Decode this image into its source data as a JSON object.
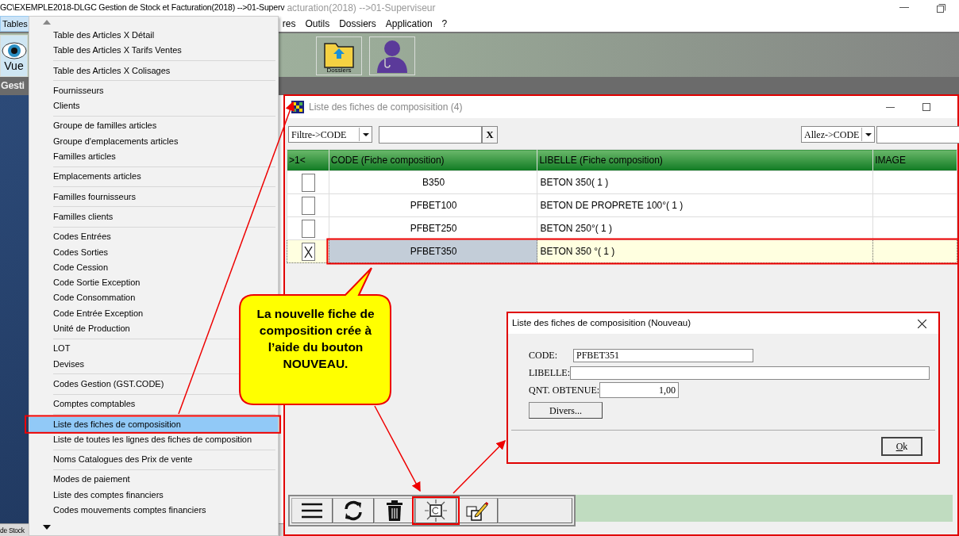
{
  "app": {
    "title": "GC\\EXEMPLE2018-DLGC Gestion de Stock et Facturation(2018) -->01-Superv",
    "title_behind": "acturation(2018) -->01-Superviseur",
    "menu": [
      {
        "label": "Tables",
        "selected": true
      },
      {
        "label": "res",
        "selected": false
      },
      {
        "label": "Outils",
        "selected": false
      },
      {
        "label": "Dossiers",
        "selected": false
      },
      {
        "label": "Application",
        "selected": false
      },
      {
        "label": "?",
        "selected": false
      }
    ],
    "toolbar": [
      {
        "kind": "vue",
        "label": "Vue"
      },
      {
        "kind": "folder",
        "label": "Dossiers"
      },
      {
        "kind": "user"
      }
    ],
    "band_title": "Gesti",
    "status": "de Stock"
  },
  "tables_menu": {
    "groups": [
      [
        {
          "label": "Table des Articles X Détail",
          "selected": false,
          "annotated": false
        },
        {
          "label": "Table des Articles X Tarifs Ventes",
          "selected": false,
          "annotated": false
        }
      ],
      [
        {
          "label": "Table des Articles X Colisages",
          "selected": false,
          "annotated": false
        }
      ],
      [
        {
          "label": "Fournisseurs",
          "selected": false,
          "annotated": false
        },
        {
          "label": "Clients",
          "selected": false,
          "annotated": false
        }
      ],
      [
        {
          "label": "Groupe de familles articles",
          "selected": false,
          "annotated": false
        },
        {
          "label": "Groupe d'emplacements articles",
          "selected": false,
          "annotated": false
        },
        {
          "label": "Familles articles",
          "selected": false,
          "annotated": false
        }
      ],
      [
        {
          "label": "Emplacements articles",
          "selected": false,
          "annotated": false
        }
      ],
      [
        {
          "label": "Familles fournisseurs",
          "selected": false,
          "annotated": false
        }
      ],
      [
        {
          "label": "Familles clients",
          "selected": false,
          "annotated": false
        }
      ],
      [
        {
          "label": "Codes Entrées",
          "selected": false,
          "annotated": false
        },
        {
          "label": "Codes Sorties",
          "selected": false,
          "annotated": false
        },
        {
          "label": "Code Cession",
          "selected": false,
          "annotated": false
        },
        {
          "label": "Code Sortie Exception",
          "selected": false,
          "annotated": false
        },
        {
          "label": "Code Consommation",
          "selected": false,
          "annotated": false
        },
        {
          "label": "Code Entrée Exception",
          "selected": false,
          "annotated": false
        },
        {
          "label": "Unité de Production",
          "selected": false,
          "annotated": false
        }
      ],
      [
        {
          "label": "LOT",
          "selected": false,
          "annotated": false
        },
        {
          "label": "Devises",
          "selected": false,
          "annotated": false
        }
      ],
      [
        {
          "label": "Codes Gestion (GST.CODE)",
          "selected": false,
          "annotated": false
        }
      ],
      [
        {
          "label": "Comptes comptables",
          "selected": false,
          "annotated": false
        }
      ],
      [
        {
          "label": "Liste des fiches de composisition",
          "selected": true,
          "annotated": true
        },
        {
          "label": "Liste de toutes les lignes des fiches de composition",
          "selected": false,
          "annotated": false
        }
      ],
      [
        {
          "label": "Noms Catalogues des Prix de vente",
          "selected": false,
          "annotated": false
        }
      ],
      [
        {
          "label": "Modes de paiement",
          "selected": false,
          "annotated": false
        },
        {
          "label": "Liste des comptes financiers",
          "selected": false,
          "annotated": false
        },
        {
          "label": "Codes mouvements comptes financiers",
          "selected": false,
          "annotated": false
        }
      ]
    ]
  },
  "list_window": {
    "title": "Liste des fiches de composisition (4)",
    "annotated": true,
    "filter": {
      "select": "Filtre->CODE",
      "clear": "X"
    },
    "goto": {
      "select": "Allez->CODE"
    },
    "table": {
      "columns": [
        ">1<",
        "CODE (Fiche composition)",
        "LIBELLE (Fiche composition)",
        "IMAGE"
      ],
      "rows": [
        {
          "checked": false,
          "selected": false,
          "annotated": false,
          "code": "B350",
          "libelle": "BETON 350( 1 )"
        },
        {
          "checked": false,
          "selected": false,
          "annotated": false,
          "code": "PFBET100",
          "libelle": "BETON DE PROPRETE 100°( 1 )"
        },
        {
          "checked": false,
          "selected": false,
          "annotated": false,
          "code": "PFBET250",
          "libelle": "BETON 250°( 1 )"
        },
        {
          "checked": true,
          "selected": true,
          "annotated": true,
          "code": "PFBET350",
          "libelle": "BETON 350 °( 1 )"
        }
      ]
    },
    "toolbar": [
      {
        "kind": "menu",
        "annotated": false
      },
      {
        "kind": "refresh",
        "annotated": false
      },
      {
        "kind": "delete",
        "annotated": false
      },
      {
        "kind": "new",
        "annotated": true
      },
      {
        "kind": "edit",
        "annotated": false
      },
      {
        "kind": "blank",
        "annotated": false
      }
    ]
  },
  "dialog": {
    "title": "Liste des fiches de composisition  (Nouveau)",
    "annotated": true,
    "fields": [
      {
        "label": "CODE:",
        "value": "PFBET351",
        "kind": "text"
      },
      {
        "label": "LIBELLE:",
        "kind": "wide"
      },
      {
        "label": "QNT. OBTENUE:",
        "value": "1,00",
        "kind": "number"
      }
    ],
    "buttons": [
      "Divers..."
    ],
    "ok": "Ok"
  },
  "callout": {
    "text": "La nouvelle fiche de composition crée à l’aide du bouton NOUVEAU."
  }
}
